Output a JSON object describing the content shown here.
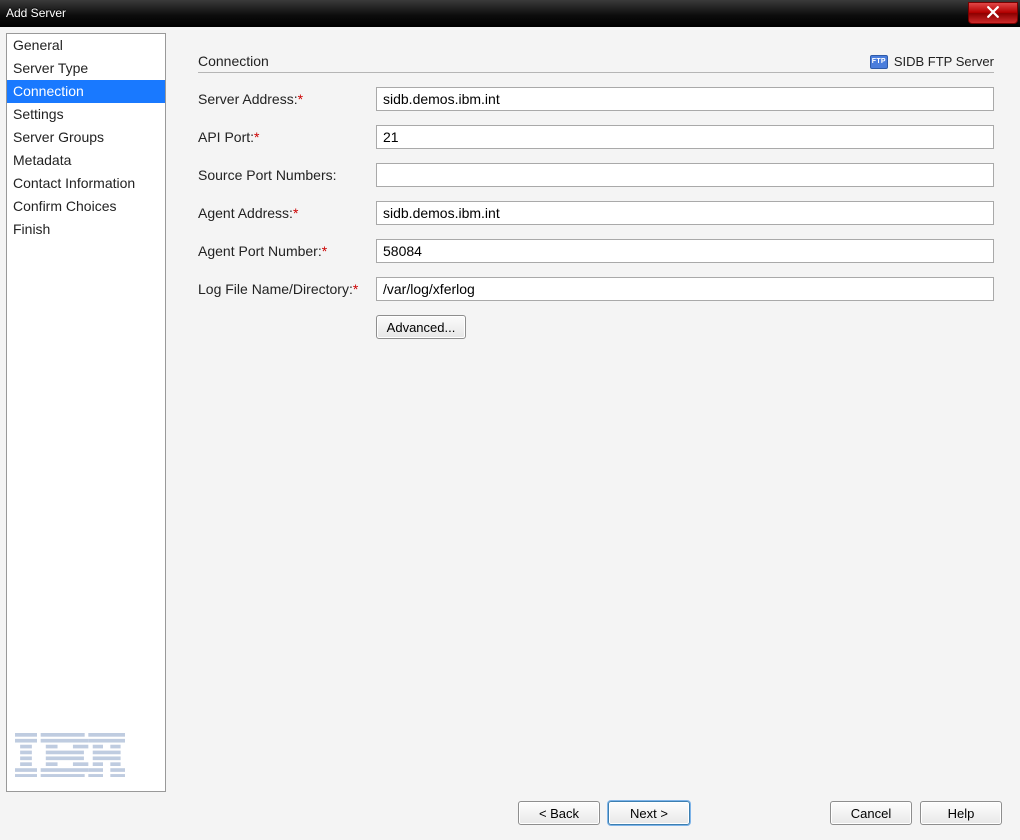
{
  "window": {
    "title": "Add Server"
  },
  "sidebar": {
    "items": [
      {
        "label": "General"
      },
      {
        "label": "Server Type"
      },
      {
        "label": "Connection",
        "selected": true
      },
      {
        "label": "Settings"
      },
      {
        "label": "Server Groups"
      },
      {
        "label": "Metadata"
      },
      {
        "label": "Contact Information"
      },
      {
        "label": "Confirm Choices"
      },
      {
        "label": "Finish"
      }
    ],
    "logo_label": "IBM"
  },
  "section": {
    "title": "Connection",
    "ftp_badge": "FTP",
    "brand_text": "SIDB FTP Server"
  },
  "form": {
    "server_address": {
      "label": "Server Address:",
      "required": true,
      "value": "sidb.demos.ibm.int"
    },
    "api_port": {
      "label": "API Port:",
      "required": true,
      "value": "21"
    },
    "source_ports": {
      "label": "Source Port Numbers:",
      "required": false,
      "value": ""
    },
    "agent_address": {
      "label": "Agent Address:",
      "required": true,
      "value": "sidb.demos.ibm.int"
    },
    "agent_port": {
      "label": "Agent Port Number:",
      "required": true,
      "value": "58084"
    },
    "log_file": {
      "label": "Log File Name/Directory:",
      "required": true,
      "value": "/var/log/xferlog"
    },
    "advanced_button": "Advanced..."
  },
  "footer": {
    "back": "< Back",
    "next": "Next >",
    "cancel": "Cancel",
    "help": "Help"
  }
}
